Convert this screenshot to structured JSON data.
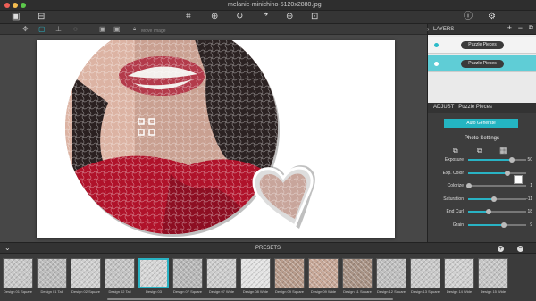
{
  "window": {
    "title": "melanie-minichino-5120x2880.jpg"
  },
  "subbar": {
    "move_image": "Move Image"
  },
  "layers": {
    "header": "LAYERS",
    "items": [
      {
        "label": "Puzzle Pieces"
      },
      {
        "label": "Puzzle Pieces"
      }
    ]
  },
  "adjust": {
    "header": "ADJUST : Puzzle Pieces",
    "auto_generate": "Auto Generate",
    "photo_settings": "Photo Settings",
    "sliders": [
      {
        "label": "Exposure",
        "value": "50",
        "level": 0.75
      },
      {
        "label": "Exp. Color",
        "value": "",
        "level": 0.68
      },
      {
        "label": "Colorize",
        "value": "1",
        "level": 0.02
      },
      {
        "label": "Saturation",
        "value": "-11",
        "level": 0.45
      },
      {
        "label": "End Curl",
        "value": "18",
        "level": 0.35
      },
      {
        "label": "Grain",
        "value": "9",
        "level": 0.62
      }
    ]
  },
  "presets": {
    "header": "PRESETS",
    "items": [
      {
        "label": "Design 01 Square"
      },
      {
        "label": "Design 01 Tall"
      },
      {
        "label": "Design 02 Square"
      },
      {
        "label": "Design 02 Tall"
      },
      {
        "label": "Design 03"
      },
      {
        "label": "Design 07 Square"
      },
      {
        "label": "Design 07 Wide"
      },
      {
        "label": "Design 08 Wide"
      },
      {
        "label": "Design 09 Square"
      },
      {
        "label": "Design 09 Wide"
      },
      {
        "label": "Design 11 Square"
      },
      {
        "label": "Design 12 Square"
      },
      {
        "label": "Design 13 Square"
      },
      {
        "label": "Design 14 Wide"
      },
      {
        "label": "Design 15 Wide"
      },
      {
        "label": "Design 16 Wide"
      }
    ]
  },
  "colors": {
    "accent": "#24b5c2",
    "lips": "#c9243a",
    "dress": "#b0122a"
  }
}
